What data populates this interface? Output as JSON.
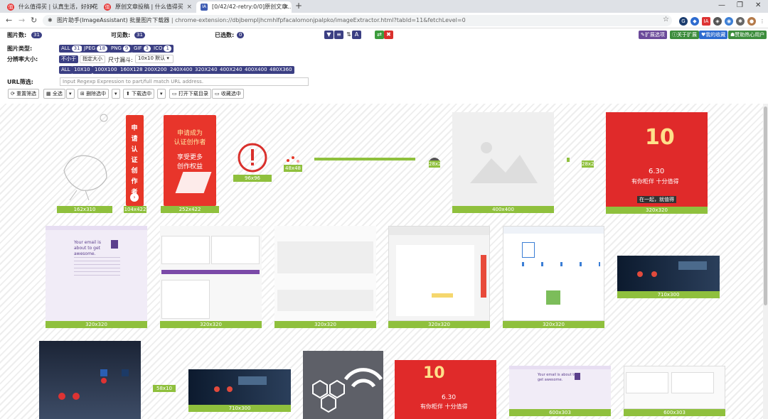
{
  "tabs": [
    {
      "label": "什么值得买 | 认真生活，好好花钱",
      "icon": "smzdm-icon",
      "active": false
    },
    {
      "label": "原创文章投稿 | 什么值得买",
      "icon": "smzdm-icon",
      "active": false
    },
    {
      "label": "[0/42/42-retry:0/0]原创文章...",
      "icon": "ia-icon",
      "active": true
    }
  ],
  "address": {
    "title": "图片助手(ImageAssistant) 批量图片下载器",
    "url": "chrome-extension://dbjbempljhcmhlfpfacalomonjpalpko/imageExtractor.html?tabId=11&fetchLevel=0"
  },
  "stats": {
    "image_count_label": "图片数:",
    "image_count": "31",
    "visible_label": "可见数:",
    "visible_count": "31",
    "selected_label": "已选数:",
    "selected_count": "0"
  },
  "right_buttons": {
    "ext_options": "扩展选项",
    "about": "关于扩展",
    "my_favorites": "我的收藏",
    "donate": "赞助热心用户"
  },
  "type_filter": {
    "label": "图片类型:",
    "items": [
      {
        "name": "ALL",
        "count": "31"
      },
      {
        "name": "JPEG",
        "count": "18"
      },
      {
        "name": "PNG",
        "count": "9"
      },
      {
        "name": "GIF",
        "count": "3"
      },
      {
        "name": "ICO",
        "count": "1"
      }
    ]
  },
  "resolution": {
    "label": "分辨率大小:",
    "mode_on": "不小于",
    "mode_off": "指定大小",
    "size_label": "尺寸漏斗:",
    "size_select": "10x10 默认",
    "sizes": [
      "ALL",
      "10X10",
      "100X100",
      "160X128",
      "200X200",
      "240X400",
      "320X240",
      "400X240",
      "400X400",
      "480X360"
    ]
  },
  "url_filter": {
    "label": "URL筛选:",
    "placeholder": "Input Regexp Expression to part/full match URL address."
  },
  "actions": {
    "refilter": "重置筛选",
    "select_all": "全选",
    "delete": "删除选中",
    "download": "下载选中",
    "open_dir": "打开下载目录",
    "favorite": "收藏选中"
  },
  "images": [
    {
      "size": "162x310"
    },
    {
      "size": "104x422"
    },
    {
      "size": "252x422"
    },
    {
      "size": "96x96"
    },
    {
      "size": "48x48"
    },
    {
      "size": "28x2"
    },
    {
      "size": "400x400"
    },
    {
      "size": "28x2"
    },
    {
      "size": "320x320"
    },
    {
      "size": "320x320"
    },
    {
      "size": "320x320"
    },
    {
      "size": "320x320"
    },
    {
      "size": "320x320"
    },
    {
      "size": "320x320"
    },
    {
      "size": "710x300"
    },
    {
      "size": "58x10"
    },
    {
      "size": "710x300"
    },
    {
      "size": "600x303"
    },
    {
      "size": "600x303"
    }
  ],
  "thumb_text": {
    "poster1": "申请认证创作者",
    "poster2_line1": "申请成为",
    "poster2_line2": "认证创作者",
    "poster2_line3": "享受更多",
    "poster2_line4": "创作权益",
    "promo_date": "6.30",
    "promo_slogan": "有你柜伴 十分值得",
    "promo_btn": "在一起，就值得",
    "email_title": "Your email is about to get awesome.",
    "mini_date": "6.30",
    "mini_slogan": "有你柜伴 十分值得"
  },
  "colors": {
    "accent": "#3b3f83",
    "green": "#8fc03d",
    "red": "#e62e2e"
  }
}
